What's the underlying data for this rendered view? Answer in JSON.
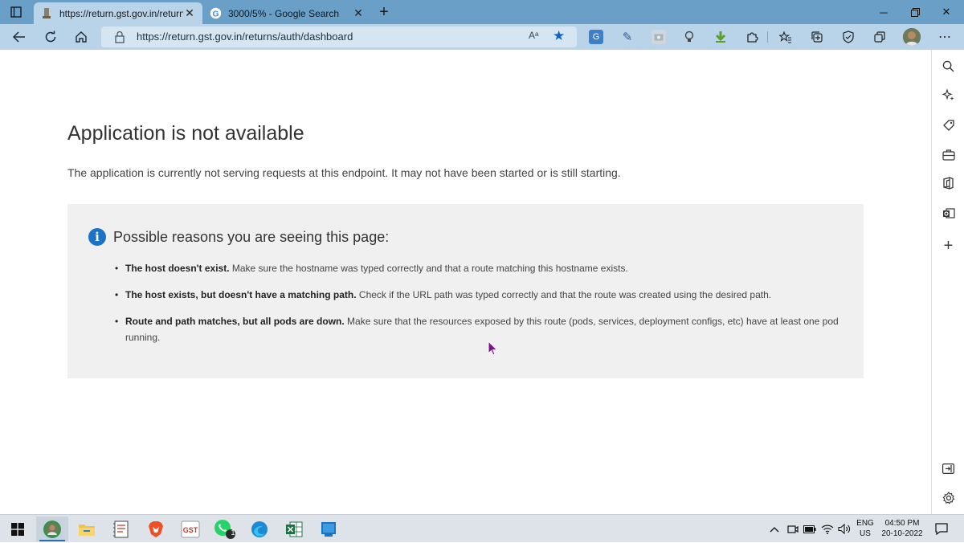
{
  "browser": {
    "tabs": [
      {
        "title": "https://return.gst.gov.in/returns/",
        "active": true,
        "favicon": "gov-emblem-icon"
      },
      {
        "title": "3000/5% - Google Search",
        "active": false,
        "favicon": "google-icon"
      }
    ],
    "address_url": "https://return.gst.gov.in/returns/auth/dashboard",
    "read_aloud_label": "Aᵃ",
    "accent": "#1565c0"
  },
  "page": {
    "title": "Application is not available",
    "description": "The application is currently not serving requests at this endpoint. It may not have been started or is still starting.",
    "reasons_heading": "Possible reasons you are seeing this page:",
    "reasons": [
      {
        "bold": "The host doesn't exist.",
        "text": " Make sure the hostname was typed correctly and that a route matching this hostname exists."
      },
      {
        "bold": "The host exists, but doesn't have a matching path.",
        "text": " Check if the URL path was typed correctly and that the route was created using the desired path."
      },
      {
        "bold": "Route and path matches, but all pods are down.",
        "text": " Make sure that the resources exposed by this route (pods, services, deployment configs, etc) have at least one pod running."
      }
    ]
  },
  "taskbar": {
    "whatsapp_badge": "1",
    "lang_line1": "ENG",
    "lang_line2": "US",
    "time": "04:50 PM",
    "date": "20-10-2022"
  }
}
